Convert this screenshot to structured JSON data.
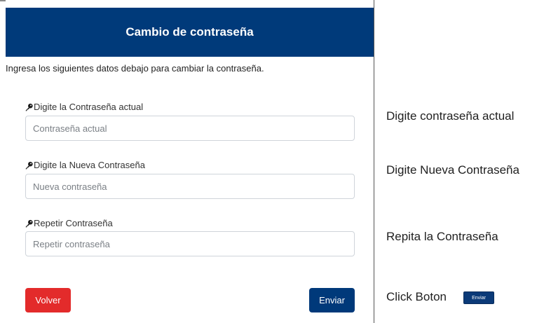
{
  "form": {
    "title": "Cambio de contraseña",
    "intro": "Ingresa los siguientes datos debajo para cambiar la contraseña.",
    "fields": [
      {
        "label": "Digite la Contraseña actual",
        "placeholder": "Contraseña actual",
        "value": "",
        "icon": "key-icon"
      },
      {
        "label": "Digite la Nueva Contraseña",
        "placeholder": "Nueva contraseña",
        "value": "",
        "icon": "key-icon"
      },
      {
        "label": "Repetir Contraseña",
        "placeholder": "Repetir contraseña",
        "value": "",
        "icon": "key-icon"
      }
    ],
    "back_label": "Volver",
    "send_label": "Enviar"
  },
  "notes": {
    "current": "Digite contraseña actual",
    "new": "Digite Nueva Contraseña",
    "repeat": "Repita la Contraseña",
    "click": "Click Boton",
    "mini_button_label": "Enviar"
  },
  "colors": {
    "header": "#003a7a",
    "back_button": "#e32b2b",
    "send_button": "#00397a"
  }
}
